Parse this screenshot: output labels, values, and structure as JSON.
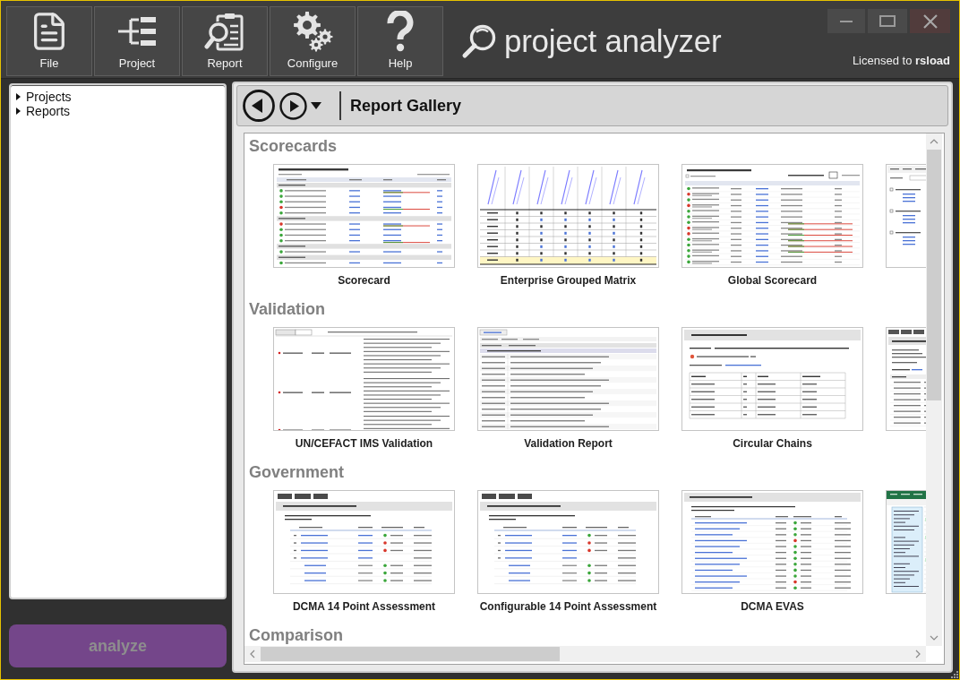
{
  "toolbar": {
    "buttons": [
      {
        "label": "File",
        "kind": "file"
      },
      {
        "label": "Project",
        "kind": "project"
      },
      {
        "label": "Report",
        "kind": "report"
      },
      {
        "label": "Configure",
        "kind": "configure"
      },
      {
        "label": "Help",
        "kind": "help"
      }
    ]
  },
  "logo": {
    "text": "project analyzer"
  },
  "license": "Licensed to **rsload**",
  "tree": {
    "items": [
      {
        "label": "Projects",
        "expanded": false
      },
      {
        "label": "Reports",
        "expanded": false
      }
    ]
  },
  "analyze_button": {
    "label": "analyze",
    "disabled": true
  },
  "gallery": {
    "title": "Report Gallery",
    "sections": [
      {
        "title": "Scorecards",
        "items": [
          {
            "label": "Scorecard",
            "kind": "scorecard"
          },
          {
            "label": "Enterprise Grouped Matrix",
            "kind": "matrix"
          },
          {
            "label": "Global Scorecard",
            "kind": "global-scorecard"
          },
          {
            "kind": "grouped-list"
          }
        ]
      },
      {
        "title": "Validation",
        "items": [
          {
            "label": "UN/CEFACT IMS Validation",
            "kind": "issue-list"
          },
          {
            "label": "Validation Report",
            "kind": "validation-list"
          },
          {
            "label": "Circular Chains",
            "kind": "chains"
          },
          {
            "kind": "path-list"
          }
        ]
      },
      {
        "title": "Government",
        "items": [
          {
            "label": "DCMA 14 Point Assessment",
            "kind": "assessment"
          },
          {
            "label": "Configurable 14 Point Assessment",
            "kind": "assessment"
          },
          {
            "label": "DCMA EVAS",
            "kind": "evas"
          },
          {
            "kind": "spreadsheet"
          }
        ]
      },
      {
        "title": "Comparison"
      }
    ]
  }
}
